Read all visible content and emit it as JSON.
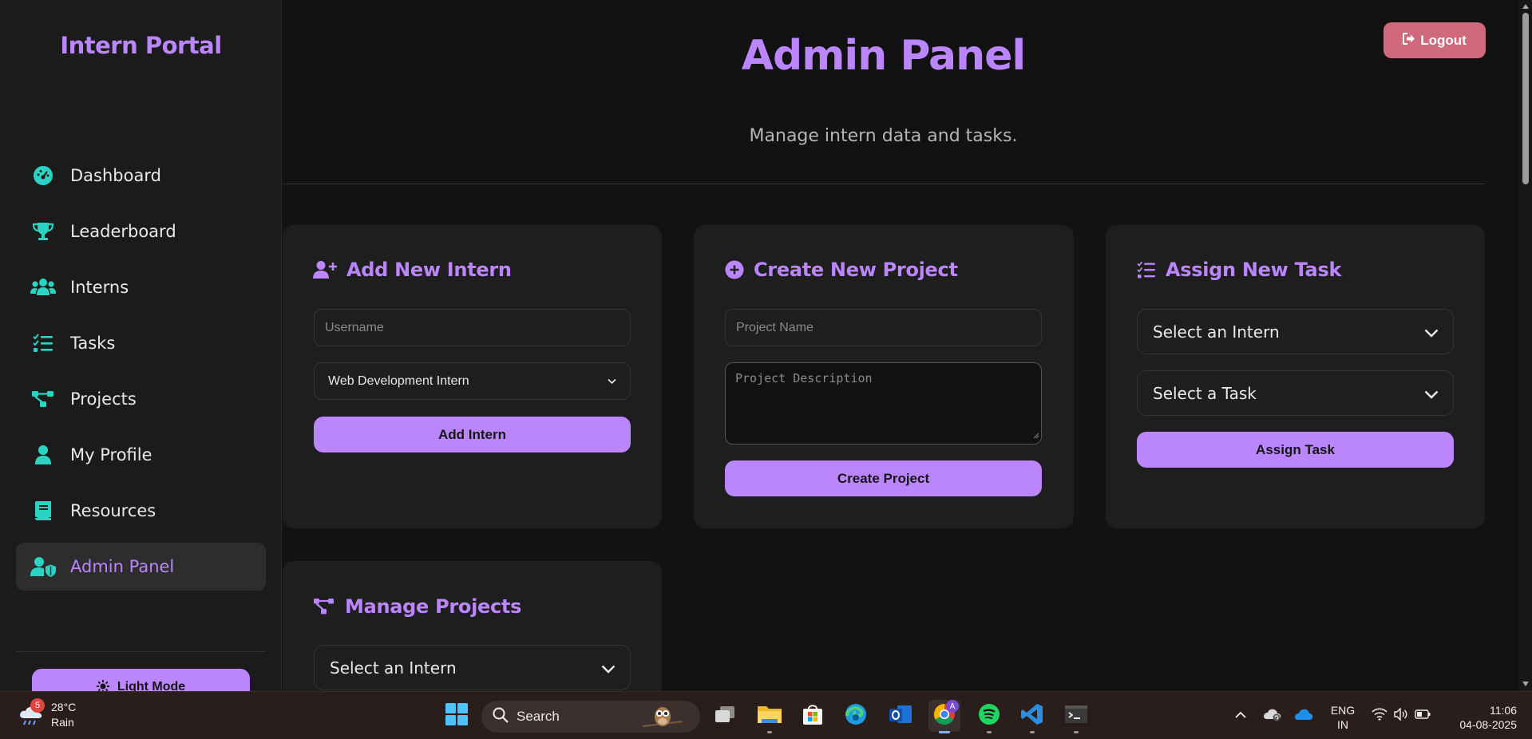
{
  "app": {
    "brand": "Intern Portal"
  },
  "sidebar": {
    "items": [
      {
        "label": "Dashboard",
        "icon": "dashboard-gauge-icon"
      },
      {
        "label": "Leaderboard",
        "icon": "trophy-icon"
      },
      {
        "label": "Interns",
        "icon": "users-icon"
      },
      {
        "label": "Tasks",
        "icon": "list-check-icon"
      },
      {
        "label": "Projects",
        "icon": "project-diagram-icon"
      },
      {
        "label": "My Profile",
        "icon": "user-icon"
      },
      {
        "label": "Resources",
        "icon": "book-icon"
      },
      {
        "label": "Admin Panel",
        "icon": "user-shield-icon",
        "active": true
      }
    ],
    "light_mode_label": "Light Mode"
  },
  "header": {
    "title": "Admin Panel",
    "subtitle": "Manage intern data and tasks.",
    "logout_label": "Logout"
  },
  "cards": {
    "add_intern": {
      "title": "Add New Intern",
      "username_placeholder": "Username",
      "role_value": "Web Development Intern",
      "button_label": "Add Intern"
    },
    "create_project": {
      "title": "Create New Project",
      "name_placeholder": "Project Name",
      "description_placeholder": "Project Description",
      "button_label": "Create Project"
    },
    "assign_task": {
      "title": "Assign New Task",
      "intern_select": "Select an Intern",
      "task_select": "Select a Task",
      "button_label": "Assign Task"
    },
    "manage_projects": {
      "title": "Manage Projects",
      "intern_select": "Select an Intern"
    }
  },
  "taskbar": {
    "weather": {
      "badge": "5",
      "temp": "28°C",
      "condition": "Rain"
    },
    "search_label": "Search",
    "language": [
      "ENG",
      "IN"
    ],
    "time": "11:06",
    "date": "04-08-2025",
    "chrome_profile": "A"
  },
  "colors": {
    "accent": "#bb86fc",
    "teal_icons": "#2ad4c3",
    "logout": "#d1697c",
    "background": "#121212",
    "card": "#1e1e1e"
  }
}
